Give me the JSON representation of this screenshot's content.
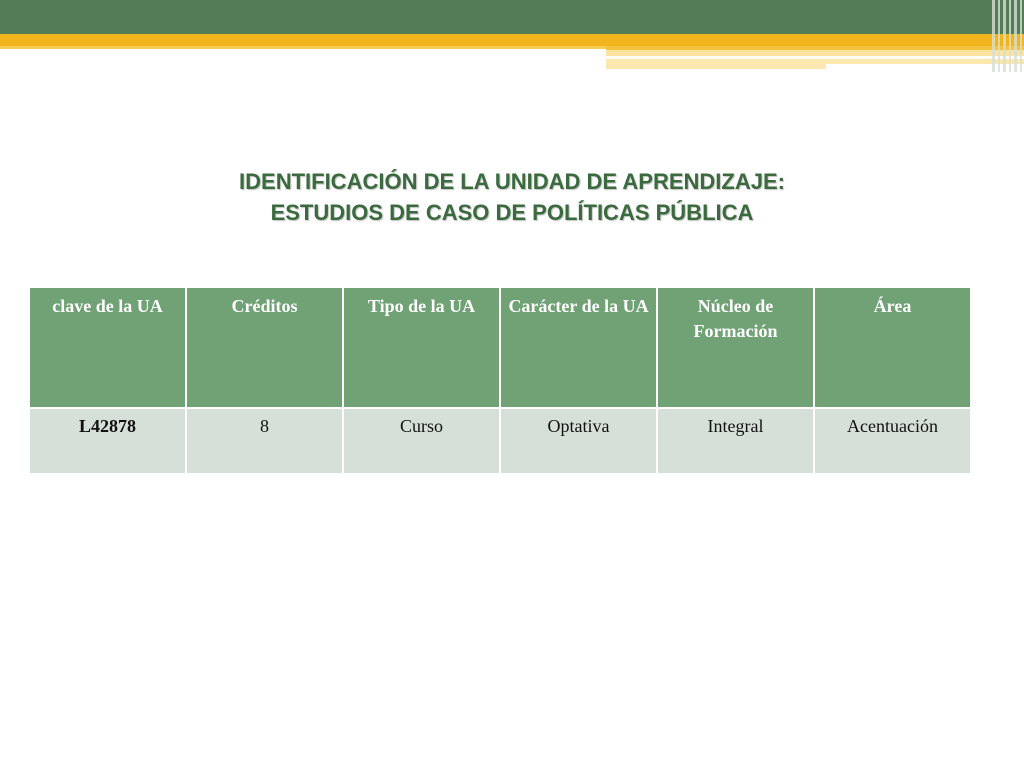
{
  "title": {
    "line1": "IDENTIFICACIÓN DE LA UNIDAD DE APRENDIZAJE:",
    "line2": "ESTUDIOS DE CASO DE POLÍTICAS PÚBLICA"
  },
  "table": {
    "headers": [
      "clave de la UA",
      "Créditos",
      "Tipo de la UA",
      "Carácter de la UA",
      "Núcleo de Formación",
      "Área"
    ],
    "rows": [
      [
        "L42878",
        "8",
        "Curso",
        "Optativa",
        "Integral",
        "Acentuación"
      ]
    ]
  },
  "colors": {
    "banner_green": "#537d57",
    "banner_gold": "#f2b41c",
    "title_green": "#3a6a3e",
    "header_fill": "#70a275",
    "row_fill": "#d7e0d8"
  }
}
